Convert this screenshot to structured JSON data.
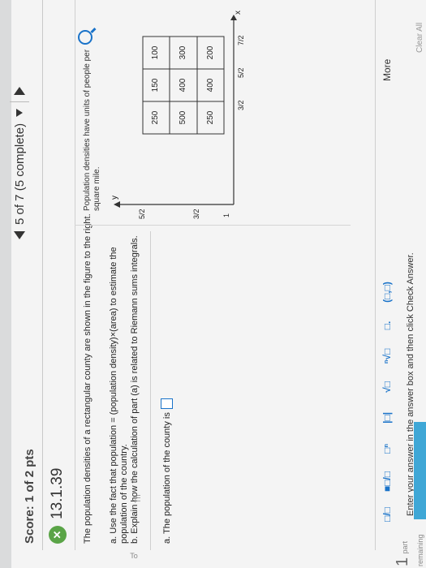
{
  "header": {
    "score_label": "Score:",
    "score_value": "1 of 2 pts",
    "nav_text": "5 of 7 (5 complete)"
  },
  "question": {
    "id": "13.1.39",
    "intro": "The population densities of a rectangular county are shown in the figure to the right.",
    "part_a": "a. Use the fact that population = (population density)×(area) to estimate the population of the country.",
    "part_b": "b. Explain how the calculation of part (a) is related to Riemann sums integrals.",
    "answer_prompt": "a. The population of the county is"
  },
  "figure": {
    "note": "Population densities have units of people per square mile.",
    "x_label": "x",
    "y_label": "y",
    "x_ticks": [
      "3/2",
      "5/2",
      "7/2"
    ],
    "y_ticks": [
      "1",
      "3/2",
      "5/2"
    ],
    "grid": [
      [
        "250",
        "150",
        "100"
      ],
      [
        "500",
        "400",
        "300"
      ],
      [
        "250",
        "400",
        "200"
      ]
    ]
  },
  "toolbar": {
    "tools": [
      "□/□",
      "■□/□",
      "□ⁿ",
      "|□|",
      "√□",
      "ⁿ√□",
      "□.",
      "(□,□)"
    ],
    "more_label": "More",
    "instructions": "Enter your answer in the answer box and then click Check Answer.",
    "parts_remaining_num": "1",
    "parts_remaining_label": "part remaining",
    "clear_label": "Clear All"
  },
  "side": {
    "to_text": "To",
    "th_text": "Th"
  }
}
